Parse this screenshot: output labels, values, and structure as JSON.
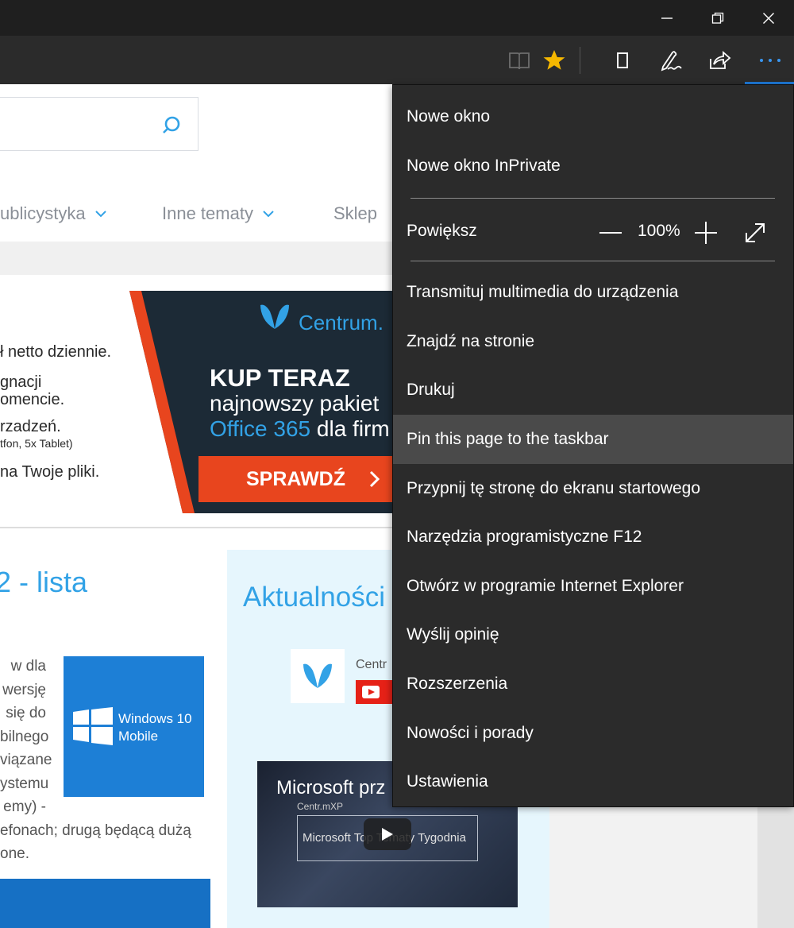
{
  "colors": {
    "accent": "#1e78d6",
    "favorite_star": "#f5b700",
    "menu_bg": "#2b2b2b",
    "menu_hover": "#4a4a4a",
    "site_blue": "#32a2e6",
    "cta_orange": "#e8451e"
  },
  "titlebar": {
    "icons": [
      "minimize-icon",
      "restore-icon",
      "close-icon"
    ]
  },
  "toolbar": {
    "icons": [
      "reading-view-icon",
      "favorite-star-icon",
      "reading-list-icon",
      "web-note-icon",
      "share-icon",
      "more-actions-icon"
    ]
  },
  "page": {
    "nav": [
      {
        "label": "ublicystyka"
      },
      {
        "label": "Inne tematy"
      },
      {
        "label": "Sklep"
      }
    ],
    "banner": {
      "lines": [
        "ł netto dziennie.",
        "gnacji",
        "omencie.",
        "rzadzeń.",
        "tfon, 5x Tablet)",
        "na Twoje pliki."
      ],
      "brand": "Centrum.",
      "headline": "KUP TERAZ",
      "line1": "najnowszy pakiet",
      "office": "Office 365",
      "office_suffix": " dla firm",
      "cta": "SPRAWDŹ"
    },
    "article": {
      "title": "2 - lista",
      "lines": [
        "w  dla",
        "wersję",
        "się do",
        "bilnego",
        "viązane",
        "ystemu",
        "emy) -",
        "efonach;  drugą  będącą  dużą",
        "one."
      ],
      "tile_line1": "Windows 10",
      "tile_line2": "Mobile"
    },
    "news": {
      "title": "Aktualności",
      "channel": "Centr",
      "video_title": "Microsoft prz",
      "video_watermark": "Centr.mXP",
      "video_box": "Microsoft Top Tematy Tygodnia"
    }
  },
  "menu": {
    "items_top": [
      {
        "label": "Nowe okno"
      },
      {
        "label": "Nowe okno InPrivate"
      }
    ],
    "zoom": {
      "label": "Powiększ",
      "value": "100%"
    },
    "items": [
      {
        "label": "Transmituj multimedia do urządzenia"
      },
      {
        "label": "Znajdź na stronie"
      },
      {
        "label": "Drukuj"
      },
      {
        "label": "Pin this page to the taskbar"
      },
      {
        "label": "Przypnij tę stronę do ekranu startowego"
      },
      {
        "label": "Narzędzia programistyczne F12"
      },
      {
        "label": "Otwórz w programie Internet Explorer"
      },
      {
        "label": "Wyślij opinię"
      },
      {
        "label": "Rozszerzenia"
      },
      {
        "label": "Nowości i porady"
      },
      {
        "label": "Ustawienia"
      }
    ],
    "hovered_item": "Pin this page to the taskbar"
  }
}
